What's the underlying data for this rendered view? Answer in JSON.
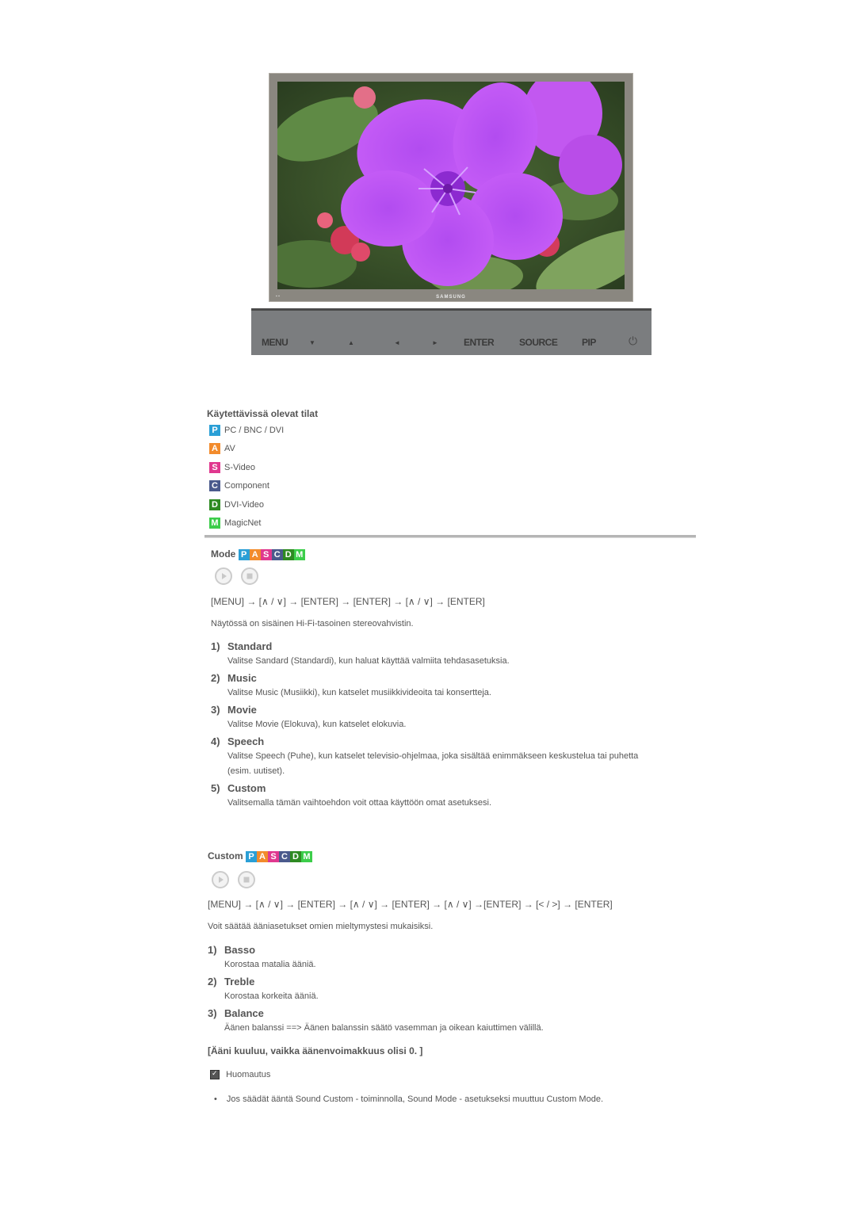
{
  "monitor": {
    "brand": "SAMSUNG",
    "screen_image": "flower-photo"
  },
  "control_bar": {
    "buttons": [
      {
        "label": "MENU",
        "icon": ""
      },
      {
        "label": "▼",
        "icon": "down-arrow"
      },
      {
        "label": "▲",
        "icon": "up-arrow"
      },
      {
        "label": "◄",
        "icon": "left-arrow"
      },
      {
        "label": "►",
        "icon": "right-arrow"
      },
      {
        "label": "ENTER",
        "icon": ""
      },
      {
        "label": "SOURCE",
        "icon": ""
      },
      {
        "label": "PIP",
        "icon": ""
      },
      {
        "label": "⏻",
        "icon": "power-icon"
      }
    ]
  },
  "available_modes": {
    "title": "Käytettävissä olevat tilat",
    "items": [
      {
        "letter": "P",
        "label": "PC / BNC / DVI",
        "color": "#2a9fd6"
      },
      {
        "letter": "A",
        "label": "AV",
        "color": "#f28b2c"
      },
      {
        "letter": "S",
        "label": "S-Video",
        "color": "#e0388f"
      },
      {
        "letter": "C",
        "label": "Component",
        "color": "#4a5a8c"
      },
      {
        "letter": "D",
        "label": "DVI-Video",
        "color": "#2e8a22"
      },
      {
        "letter": "M",
        "label": "MagicNet",
        "color": "#3ccd4a"
      }
    ]
  },
  "mode_section": {
    "title": "Mode",
    "badges": [
      "P",
      "A",
      "S",
      "C",
      "D",
      "M"
    ],
    "nav_path": "[MENU] → [∧ / ∨] → [ENTER] → [ENTER] → [∧ / ∨] → [ENTER]",
    "intro": "Näytössä on sisäinen Hi-Fi-tasoinen stereovahvistin.",
    "items": [
      {
        "num": "1)",
        "title": "Standard",
        "desc": "Valitse Sandard (Standardi), kun haluat käyttää valmiita tehdasasetuksia."
      },
      {
        "num": "2)",
        "title": "Music",
        "desc": "Valitse Music (Musiikki), kun katselet musiikkivideoita tai konsertteja."
      },
      {
        "num": "3)",
        "title": "Movie",
        "desc": "Valitse Movie (Elokuva), kun katselet elokuvia."
      },
      {
        "num": "4)",
        "title": "Speech",
        "desc": "Valitse Speech (Puhe), kun katselet televisio-ohjelmaa, joka sisältää enimmäkseen keskustelua tai puhetta",
        "desc2": "(esim. uutiset)."
      },
      {
        "num": "5)",
        "title": "Custom",
        "desc": "Valitsemalla tämän vaihtoehdon voit ottaa käyttöön omat asetuksesi."
      }
    ]
  },
  "custom_section": {
    "title": "Custom",
    "badges": [
      "P",
      "A",
      "S",
      "C",
      "D",
      "M"
    ],
    "nav_path": "[MENU] → [∧ / ∨] → [ENTER] → [∧ / ∨] → [ENTER] → [∧ / ∨] →[ENTER] → [< / >] → [ENTER]",
    "intro": "Voit säätää ääniasetukset omien mieltymystesi mukaisiksi.",
    "items": [
      {
        "num": "1)",
        "title": "Basso",
        "desc": "Korostaa matalia ääniä."
      },
      {
        "num": "2)",
        "title": "Treble",
        "desc": "Korostaa korkeita ääniä."
      },
      {
        "num": "3)",
        "title": "Balance",
        "desc": "Äänen balanssi ==> Äänen balanssin säätö vasemman ja oikean kaiuttimen välillä."
      }
    ]
  },
  "note_section": {
    "heading": "[Ääni kuuluu, vaikka äänenvoimakkuus olisi 0. ]",
    "note_label": "Huomautus",
    "bullets": [
      "Jos säädät ääntä Sound Custom - toiminnolla, Sound Mode - asetukseksi muuttuu Custom Mode."
    ]
  }
}
